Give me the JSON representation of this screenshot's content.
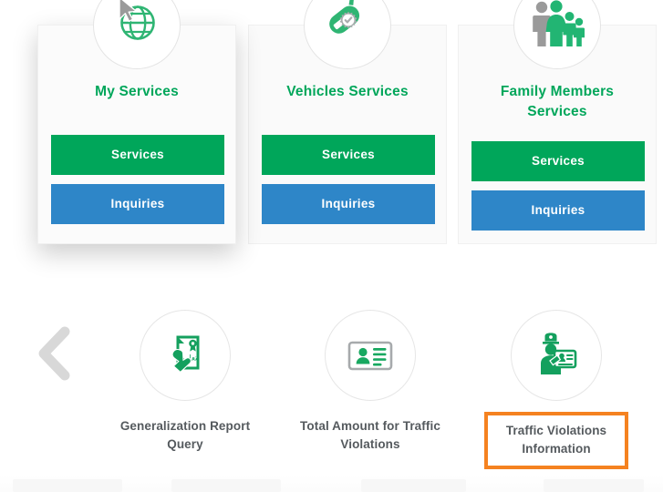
{
  "service_cards": [
    {
      "icon": "globe-cursor-icon",
      "title": "My Services",
      "services_label": "Services",
      "inquiries_label": "Inquiries"
    },
    {
      "icon": "car-key-gear-check-icon",
      "title": "Vehicles Services",
      "services_label": "Services",
      "inquiries_label": "Inquiries"
    },
    {
      "icon": "family-members-icon",
      "title": "Family Members Services",
      "title_line1": "Family Members",
      "title_line2": "Services",
      "services_label": "Services",
      "inquiries_label": "Inquiries"
    }
  ],
  "carousel": {
    "prev_arrow": "chevron-left-icon",
    "items": [
      {
        "icon": "hand-holding-certificate-icon",
        "icon_text": "تعاميم",
        "label": "Generalization Report Query",
        "label_line1": "Generalization Report",
        "label_line2": "Query",
        "highlighted": false
      },
      {
        "icon": "id-card-icon",
        "label": "Total Amount for Traffic Violations",
        "label_line1": "Total Amount for Traffic",
        "label_line2": "Violations",
        "highlighted": false
      },
      {
        "icon": "police-officer-ticket-icon",
        "label": "Traffic Violations Information",
        "label_line1": "Traffic Violations",
        "label_line2": "Information",
        "highlighted": true
      }
    ]
  },
  "colors": {
    "green": "#00a65a",
    "blue": "#2e86c8",
    "highlight_orange": "#f58220",
    "label_gray": "#555a5e",
    "card_bg": "#fafafa",
    "arrow_gray": "#d8d8d8",
    "icon_gray": "#8e9193"
  }
}
